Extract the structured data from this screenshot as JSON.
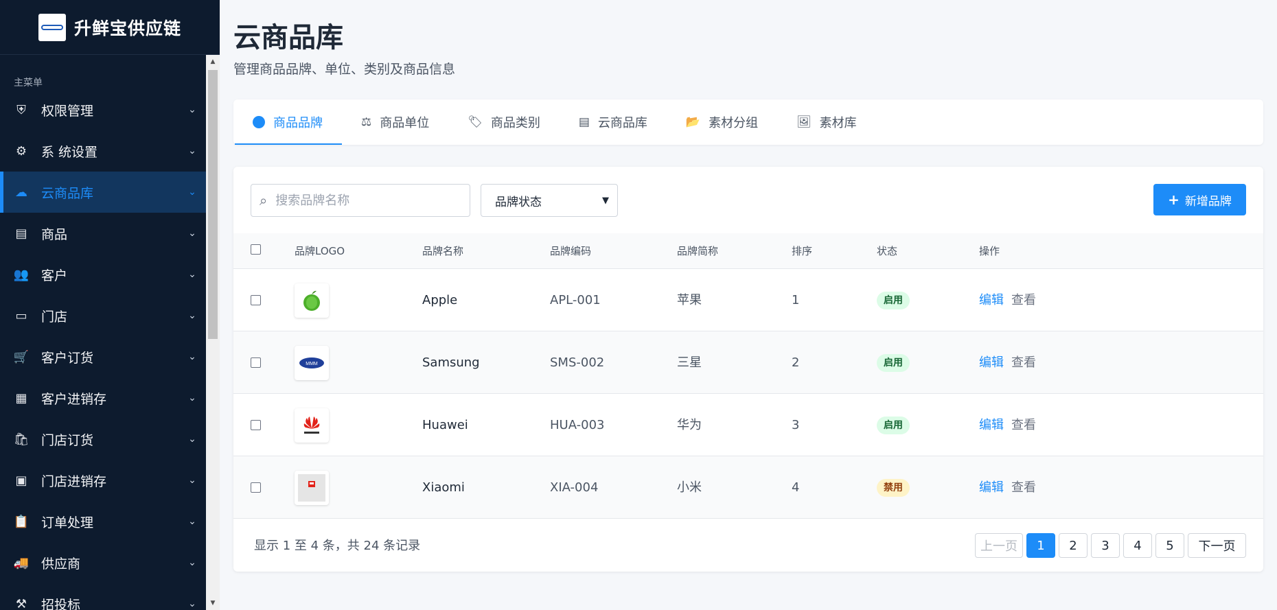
{
  "app": {
    "brand_title": "升鲜宝供应链"
  },
  "sidebar": {
    "caption": "主菜单",
    "items": [
      {
        "label": "权限管理",
        "icon": "shield-icon",
        "glyph": "⛨"
      },
      {
        "label": "系 统设置",
        "icon": "gear-icon",
        "glyph": "⚙"
      },
      {
        "label": "云商品库",
        "icon": "cloud-icon",
        "glyph": "☁",
        "active": true
      },
      {
        "label": "商品",
        "icon": "box-icon",
        "glyph": "▤"
      },
      {
        "label": "客户",
        "icon": "users-icon",
        "glyph": "👥"
      },
      {
        "label": "门店",
        "icon": "store-icon",
        "glyph": "▭"
      },
      {
        "label": "客户订货",
        "icon": "cart-icon",
        "glyph": "🛒"
      },
      {
        "label": "客户进销存",
        "icon": "warehouse-icon",
        "glyph": "▦"
      },
      {
        "label": "门店订货",
        "icon": "bag-icon",
        "glyph": "🛍"
      },
      {
        "label": "门店进销存",
        "icon": "boxes-icon",
        "glyph": "▣"
      },
      {
        "label": "订单处理",
        "icon": "clipboard-check-icon",
        "glyph": "📋"
      },
      {
        "label": "供应商",
        "icon": "truck-icon",
        "glyph": "🚚"
      },
      {
        "label": "招投标",
        "icon": "gavel-icon",
        "glyph": "⚒"
      }
    ]
  },
  "header": {
    "title": "云商品库",
    "subtitle": "管理商品品牌、单位、类别及商品信息"
  },
  "tabs": [
    {
      "label": "商品品牌",
      "icon": "copyright-icon",
      "glyph": "C",
      "active": true
    },
    {
      "label": "商品单位",
      "icon": "scale-icon",
      "glyph": "⚖"
    },
    {
      "label": "商品类别",
      "icon": "tags-icon",
      "glyph": "🏷"
    },
    {
      "label": "云商品库",
      "icon": "box-icon",
      "glyph": "▤"
    },
    {
      "label": "素材分组",
      "icon": "folder-open-icon",
      "glyph": "📂"
    },
    {
      "label": "素材库",
      "icon": "image-icon",
      "glyph": "🖼"
    }
  ],
  "toolbar": {
    "search_placeholder": "搜索品牌名称",
    "status_select_value": "品牌状态",
    "add_button_label": "新增品牌"
  },
  "table": {
    "headers": [
      "品牌LOGO",
      "品牌名称",
      "品牌编码",
      "品牌简称",
      "排序",
      "状态",
      "操作"
    ],
    "rows": [
      {
        "name": "Apple",
        "code": "APL-001",
        "short": "苹果",
        "sort": "1",
        "status": "启用",
        "status_type": "on",
        "logo": "apple-logo"
      },
      {
        "name": "Samsung",
        "code": "SMS-002",
        "short": "三星",
        "sort": "2",
        "status": "启用",
        "status_type": "on",
        "logo": "samsung-logo"
      },
      {
        "name": "Huawei",
        "code": "HUA-003",
        "short": "华为",
        "sort": "3",
        "status": "启用",
        "status_type": "on",
        "logo": "huawei-logo"
      },
      {
        "name": "Xiaomi",
        "code": "XIA-004",
        "short": "小米",
        "sort": "4",
        "status": "禁用",
        "status_type": "off",
        "logo": "xiaomi-logo"
      }
    ],
    "edit_label": "编辑",
    "view_label": "查看"
  },
  "footer": {
    "info": "显示 1 至 4 条，共 24 条记录",
    "prev_label": "上一页",
    "next_label": "下一页",
    "pages": [
      "1",
      "2",
      "3",
      "4",
      "5"
    ],
    "current_page": "1"
  },
  "colors": {
    "sidebar_bg": "#0d1b2e",
    "accent": "#1d8cf8",
    "enabled_badge_bg": "#dcfce7",
    "disabled_badge_bg": "#fef3c7"
  }
}
